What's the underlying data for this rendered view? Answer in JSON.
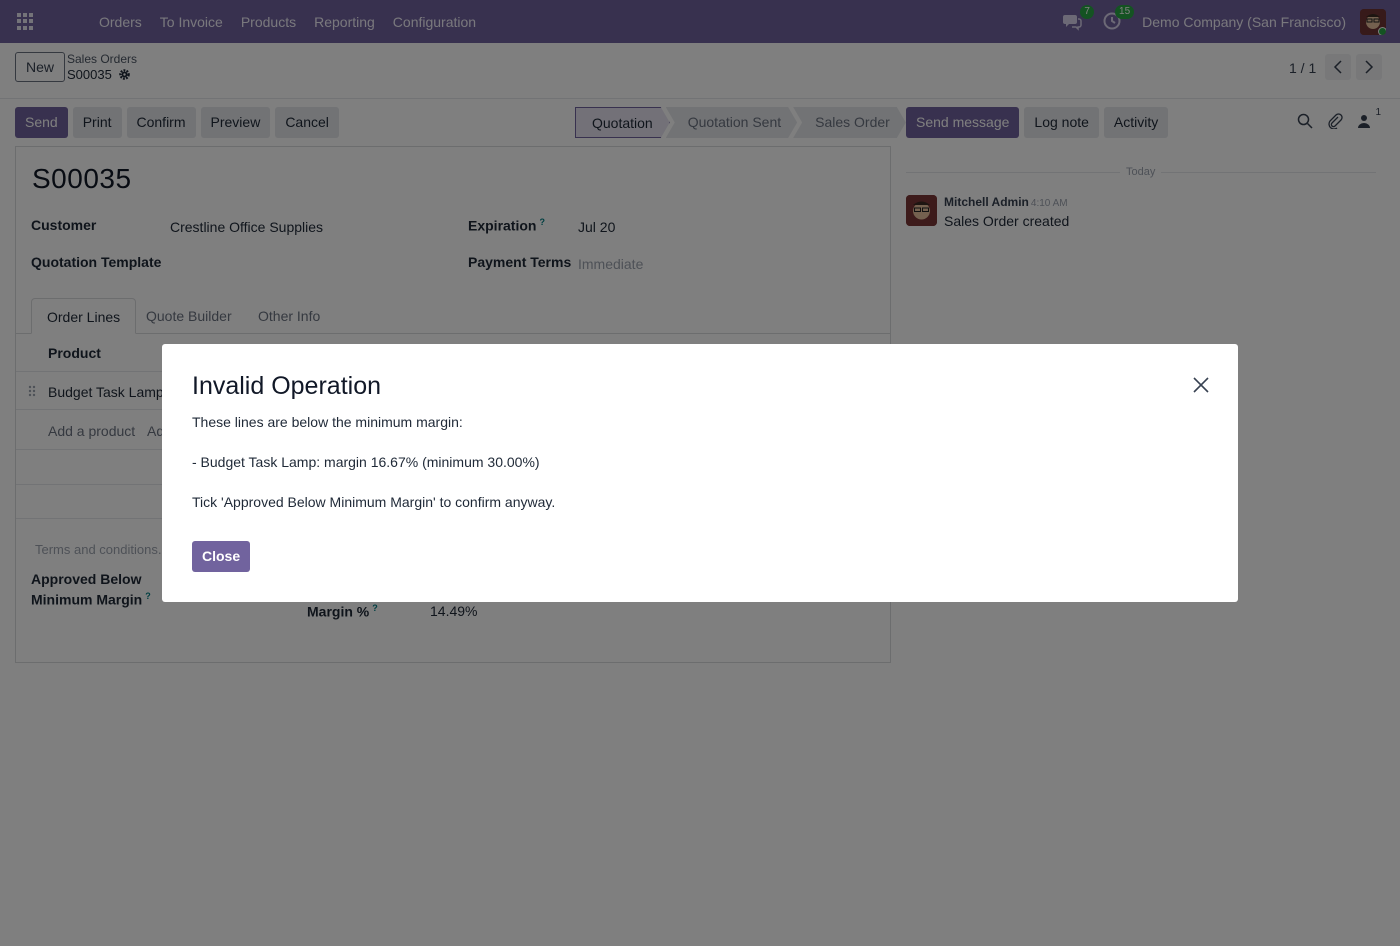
{
  "navbar": {
    "menu": [
      "Orders",
      "To Invoice",
      "Products",
      "Reporting",
      "Configuration"
    ],
    "messages_badge": "7",
    "activities_badge": "15",
    "company": "Demo Company (San Francisco)"
  },
  "control": {
    "new_label": "New",
    "breadcrumb_parent": "Sales Orders",
    "breadcrumb_current": "S00035",
    "pager": "1 / 1"
  },
  "actions": {
    "send": "Send",
    "print": "Print",
    "confirm": "Confirm",
    "preview": "Preview",
    "cancel": "Cancel"
  },
  "status": [
    "Quotation",
    "Quotation Sent",
    "Sales Order"
  ],
  "chatter": {
    "send_message": "Send message",
    "log_note": "Log note",
    "activity": "Activity",
    "followers": "1",
    "day": "Today",
    "author": "Mitchell Admin",
    "time": "4:10 AM",
    "body": "Sales Order created"
  },
  "form": {
    "name": "S00035",
    "customer_label": "Customer",
    "customer": "Crestline Office Supplies",
    "template_label": "Quotation Template",
    "expiration_label": "Expiration",
    "expiration": "Jul 20",
    "payment_label": "Payment Terms",
    "payment_placeholder": "Immediate",
    "tabs": [
      "Order Lines",
      "Quote Builder",
      "Other Info"
    ],
    "col_product": "Product",
    "line_product": "Budget Task Lamp",
    "add_product": "Add a product",
    "add_section_partial": "Ad",
    "terms": "Terms and conditions...",
    "approved_label_1": "Approved Below",
    "approved_label_2": "Minimum Margin",
    "margin_label": "Margin %",
    "margin_value": "14.49%"
  },
  "modal": {
    "title": "Invalid Operation",
    "line1": "These lines are below the minimum margin:",
    "line2": "- Budget Task Lamp: margin 16.67% (minimum 30.00%)",
    "line3": "Tick 'Approved Below Minimum Margin' to confirm anyway.",
    "close": "Close"
  },
  "colors": {
    "brand": "#71639e",
    "badge": "#28a745",
    "help": "#017e84"
  }
}
